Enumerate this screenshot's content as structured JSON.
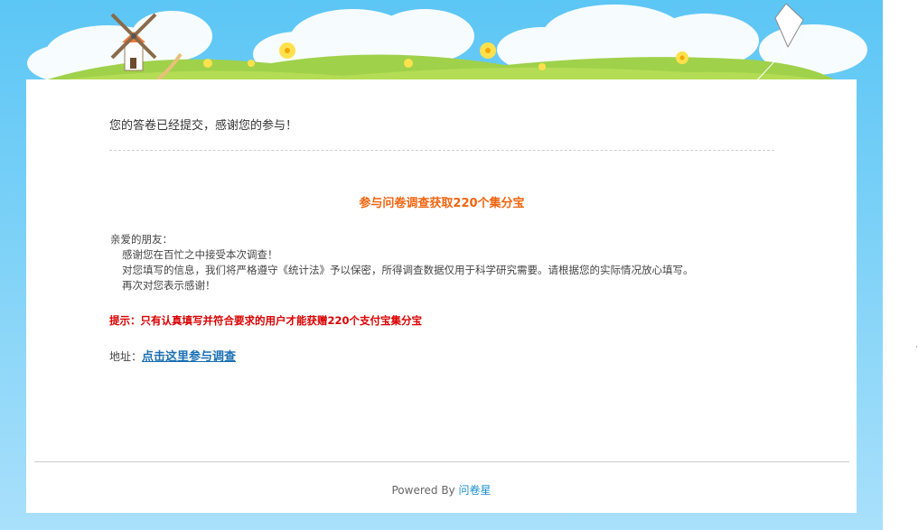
{
  "confirmation": {
    "message": "您的答卷已经提交，感谢您的参与！"
  },
  "promo": {
    "title": "参与问卷调查获取220个集分宝"
  },
  "letter": {
    "greeting": "亲爱的朋友：",
    "line1": "感谢您在百忙之中接受本次调查！",
    "line2": "对您填写的信息，我们将严格遵守《统计法》予以保密，所得调查数据仅用于科学研究需要。请根据您的实际情况放心填写。",
    "line3": "再次对您表示感谢！"
  },
  "tip": {
    "text": "提示：只有认真填写并符合要求的用户才能获赠220个支付宝集分宝"
  },
  "address": {
    "label": "地址：",
    "link_text": "点击这里参与调查"
  },
  "footer": {
    "powered_by": "Powered By",
    "brand": "问卷星"
  },
  "colors": {
    "sky": "#5cc6f5",
    "promo_title": "#f0640f",
    "tip": "#d90000",
    "link": "#1a6fb3",
    "brand": "#1a8fc7"
  }
}
